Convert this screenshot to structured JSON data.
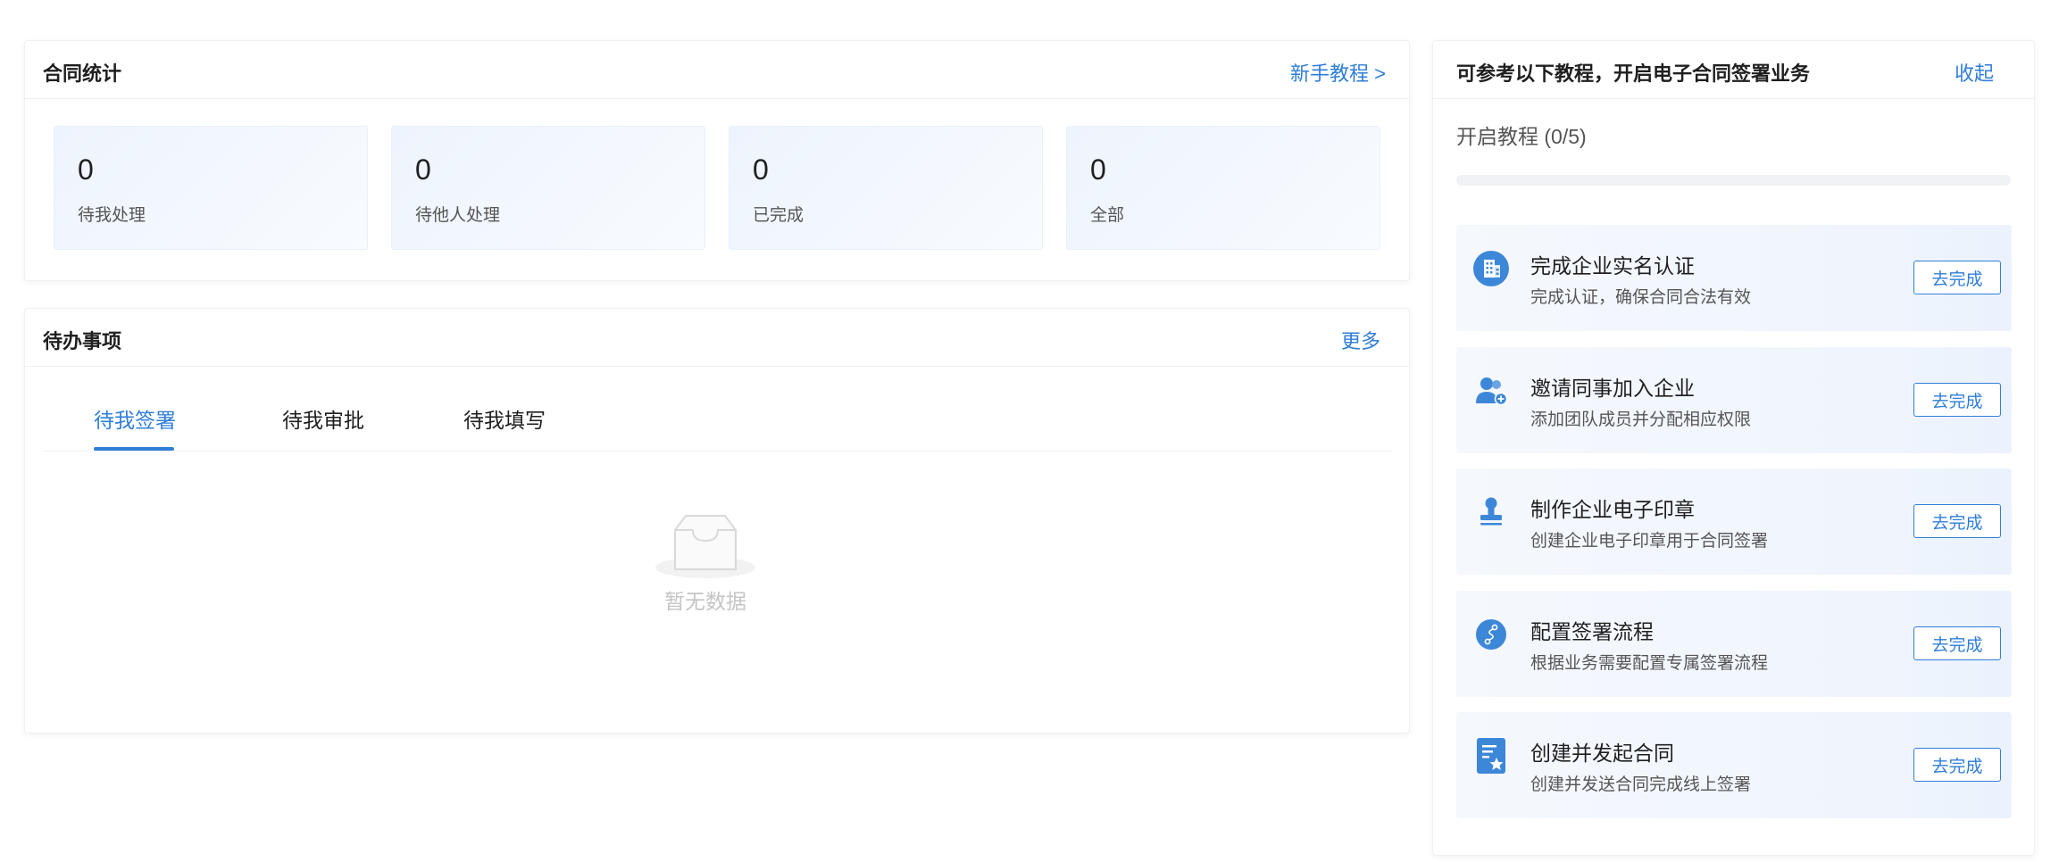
{
  "stats": {
    "title": "合同统计",
    "tutorial_link": "新手教程 >",
    "items": [
      {
        "value": "0",
        "label": "待我处理"
      },
      {
        "value": "0",
        "label": "待他人处理"
      },
      {
        "value": "0",
        "label": "已完成"
      },
      {
        "value": "0",
        "label": "全部"
      }
    ]
  },
  "todo": {
    "title": "待办事项",
    "more_link": "更多",
    "tabs": [
      {
        "label": "待我签署",
        "active": true
      },
      {
        "label": "待我审批",
        "active": false
      },
      {
        "label": "待我填写",
        "active": false
      }
    ],
    "empty_text": "暂无数据"
  },
  "tutorial": {
    "title": "可参考以下教程，开启电子合同签署业务",
    "collapse_link": "收起",
    "progress_label": "开启教程 (0/5)",
    "progress": 0,
    "accent": "#2f7ed8",
    "tasks": [
      {
        "icon": "building-icon",
        "title": "完成企业实名认证",
        "desc": "完成认证，确保合同合法有效",
        "button": "去完成"
      },
      {
        "icon": "users-add-icon",
        "title": "邀请同事加入企业",
        "desc": "添加团队成员并分配相应权限",
        "button": "去完成"
      },
      {
        "icon": "stamp-icon",
        "title": "制作企业电子印章",
        "desc": "创建企业电子印章用于合同签署",
        "button": "去完成"
      },
      {
        "icon": "workflow-icon",
        "title": "配置签署流程",
        "desc": "根据业务需要配置专属签署流程",
        "button": "去完成"
      },
      {
        "icon": "contract-star-icon",
        "title": "创建并发起合同",
        "desc": "创建并发送合同完成线上签署",
        "button": "去完成"
      }
    ]
  }
}
